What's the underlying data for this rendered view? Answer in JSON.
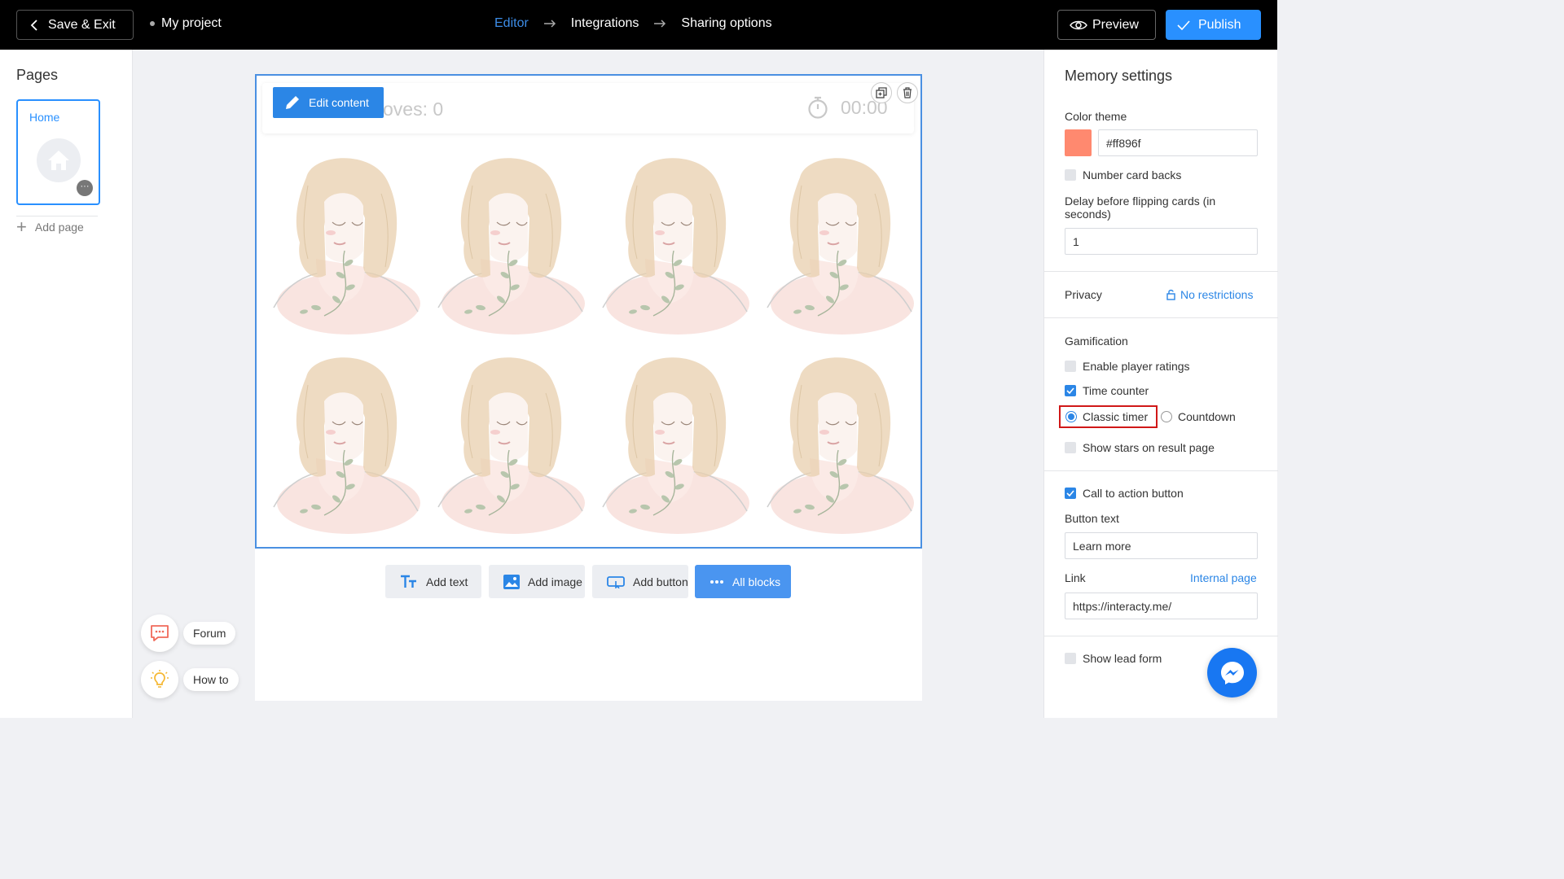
{
  "topbar": {
    "save_exit_label": "Save & Exit",
    "project_name": "My project",
    "steps": [
      "Editor",
      "Integrations",
      "Sharing options"
    ],
    "active_step": "Editor",
    "preview_label": "Preview",
    "publish_label": "Publish"
  },
  "sidebar": {
    "title": "Pages",
    "pages": [
      {
        "label": "Home"
      }
    ],
    "add_page_label": "Add page",
    "help": [
      {
        "label": "Forum",
        "icon": "chat-icon"
      },
      {
        "label": "How to",
        "icon": "lightbulb-icon"
      }
    ]
  },
  "canvas": {
    "edit_content_label": "Edit content",
    "moves_label": "oves: 0",
    "timer_value": "00:00",
    "card_count": 8,
    "toolbar": [
      {
        "label": "Add text",
        "icon": "text-icon"
      },
      {
        "label": "Add image",
        "icon": "image-icon"
      },
      {
        "label": "Add button",
        "icon": "button-icon"
      },
      {
        "label": "All blocks",
        "icon": "dots-icon"
      }
    ]
  },
  "settings": {
    "title": "Memory settings",
    "color_theme_label": "Color theme",
    "color_theme_value": "#ff896f",
    "number_card_backs_label": "Number card backs",
    "number_card_backs_checked": false,
    "delay_label": "Delay before flipping cards (in seconds)",
    "delay_value": "1",
    "privacy_label": "Privacy",
    "privacy_value": "No restrictions",
    "gamification_label": "Gamification",
    "enable_ratings_label": "Enable player ratings",
    "enable_ratings_checked": false,
    "time_counter_label": "Time counter",
    "time_counter_checked": true,
    "timer_options": [
      "Classic timer",
      "Countdown"
    ],
    "timer_selected": "Classic timer",
    "show_stars_label": "Show stars on result page",
    "show_stars_checked": false,
    "cta_label": "Call to action button",
    "cta_checked": true,
    "button_text_label": "Button text",
    "button_text_value": "Learn more",
    "link_label": "Link",
    "link_type": "Internal page",
    "link_value": "https://interacty.me/",
    "lead_form_label": "Show lead form",
    "lead_form_checked": false
  },
  "colors": {
    "topbar_bg": "#000000",
    "accent": "#2990ff",
    "theme": "#ff896f",
    "highlight": "#d01818"
  }
}
